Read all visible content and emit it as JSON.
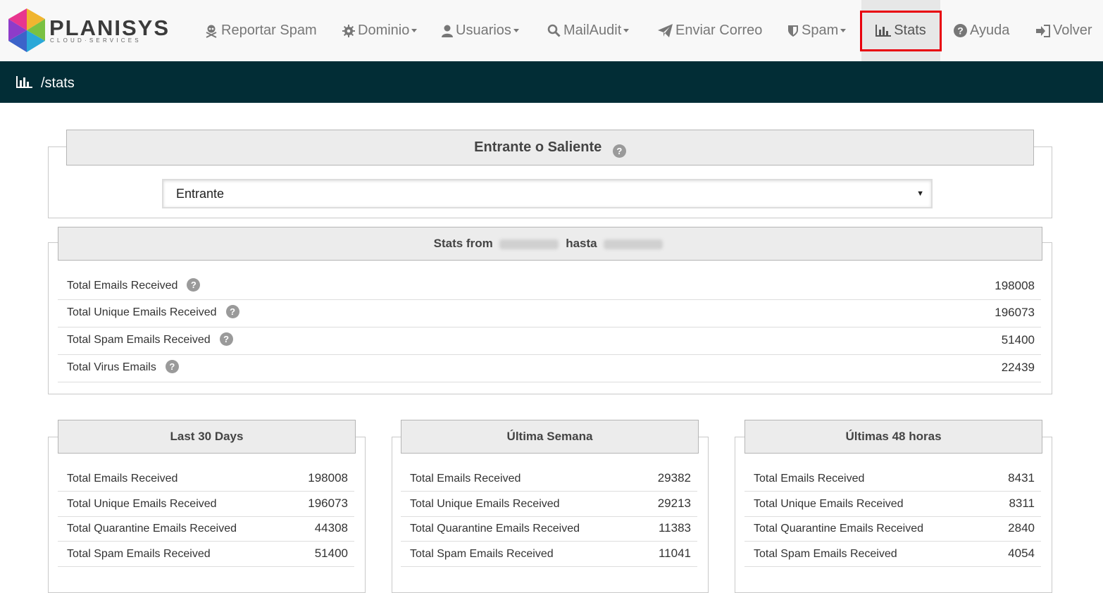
{
  "brand": {
    "name": "PLANISYS",
    "tagline": "CLOUD·SERVICES"
  },
  "nav": {
    "items": [
      {
        "label": "Reportar Spam",
        "icon": "skull-crossbones-icon",
        "dropdown": false
      },
      {
        "label": "Dominio",
        "icon": "gear-icon",
        "dropdown": true
      },
      {
        "label": "Usuarios",
        "icon": "user-icon",
        "dropdown": true
      },
      {
        "label": "MailAudit",
        "icon": "search-icon",
        "dropdown": true
      },
      {
        "label": "Enviar Correo",
        "icon": "paper-plane-icon",
        "dropdown": false
      },
      {
        "label": "Spam",
        "icon": "shield-icon",
        "dropdown": true
      },
      {
        "label": "Stats",
        "icon": "bar-chart-icon",
        "dropdown": false,
        "active": true
      },
      {
        "label": "Ayuda",
        "icon": "question-circle-icon",
        "dropdown": false
      },
      {
        "label": "Volver",
        "icon": "sign-in-icon",
        "dropdown": false
      }
    ],
    "highlight_color": "#e8000d"
  },
  "breadcrumb": {
    "path": "/stats",
    "icon": "bar-chart-icon"
  },
  "direction": {
    "title": "Entrante o Saliente",
    "selected": "Entrante"
  },
  "summary": {
    "title_prefix": "Stats from",
    "title_mid": "hasta",
    "rows": [
      {
        "label": "Total Emails Received",
        "value": "198008"
      },
      {
        "label": "Total Unique Emails Received",
        "value": "196073"
      },
      {
        "label": "Total Spam Emails Received",
        "value": "51400"
      },
      {
        "label": "Total Virus Emails",
        "value": "22439"
      }
    ]
  },
  "periods": [
    {
      "title": "Last 30 Days",
      "rows": [
        {
          "label": "Total Emails Received",
          "value": "198008"
        },
        {
          "label": "Total Unique Emails Received",
          "value": "196073"
        },
        {
          "label": "Total Quarantine Emails Received",
          "value": "44308"
        },
        {
          "label": "Total Spam Emails Received",
          "value": "51400"
        }
      ]
    },
    {
      "title": "Última Semana",
      "rows": [
        {
          "label": "Total Emails Received",
          "value": "29382"
        },
        {
          "label": "Total Unique Emails Received",
          "value": "29213"
        },
        {
          "label": "Total Quarantine Emails Received",
          "value": "11383"
        },
        {
          "label": "Total Spam Emails Received",
          "value": "11041"
        }
      ]
    },
    {
      "title": "Últimas 48 horas",
      "rows": [
        {
          "label": "Total Emails Received",
          "value": "8431"
        },
        {
          "label": "Total Unique Emails Received",
          "value": "8311"
        },
        {
          "label": "Total Quarantine Emails Received",
          "value": "2840"
        },
        {
          "label": "Total Spam Emails Received",
          "value": "4054"
        }
      ]
    }
  ],
  "colors": {
    "header_bar": "#022d36",
    "nav_bg": "#f8f8f8",
    "panel_head": "#ececec"
  }
}
